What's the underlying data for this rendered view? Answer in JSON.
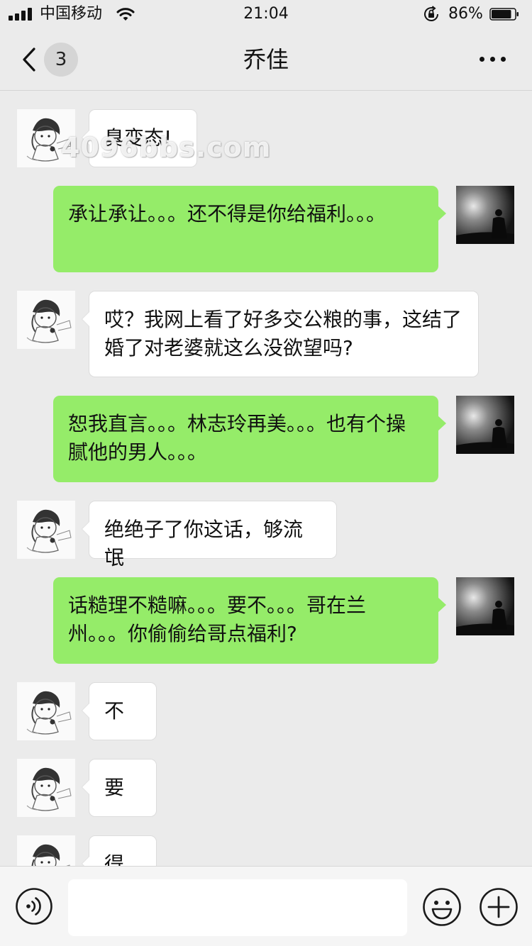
{
  "status_bar": {
    "carrier": "中国移动",
    "time": "21:04",
    "battery_percent": "86%",
    "battery_level": 0.86,
    "icons": [
      "signal-icon",
      "wifi-icon",
      "orientation-lock-icon",
      "battery-icon"
    ]
  },
  "nav": {
    "back_icon": "chevron-left-icon",
    "unread_count": "3",
    "title": "乔佳",
    "more_icon": "more-dots-icon"
  },
  "watermark": "4096bbs.com",
  "messages": [
    {
      "side": "left",
      "text": "臭变态!"
    },
    {
      "side": "right",
      "text": "承让承让。。。还不得是你给福利。。。"
    },
    {
      "side": "left",
      "text": "哎？我网上看了好多交公粮的事，这结了婚了对老婆就这么没欲望吗?"
    },
    {
      "side": "right",
      "text": "恕我直言。。。林志玲再美。。。也有个操腻他的男人。。。"
    },
    {
      "side": "left",
      "text": "绝绝子了你这话，够流氓"
    },
    {
      "side": "right",
      "text": "话糙理不糙嘛。。。要不。。。哥在兰州。。。你偷偷给哥点福利?"
    },
    {
      "side": "left",
      "text": "不"
    },
    {
      "side": "left",
      "text": "要"
    },
    {
      "side": "left",
      "text": "得"
    }
  ],
  "input_bar": {
    "voice_icon": "voice-icon",
    "input_value": "",
    "emoji_icon": "emoji-icon",
    "plus_icon": "plus-icon"
  },
  "colors": {
    "background": "#ebebeb",
    "outgoing_bubble": "#95ec69",
    "incoming_bubble": "#ffffff",
    "toolbar": "#f5f5f5"
  }
}
